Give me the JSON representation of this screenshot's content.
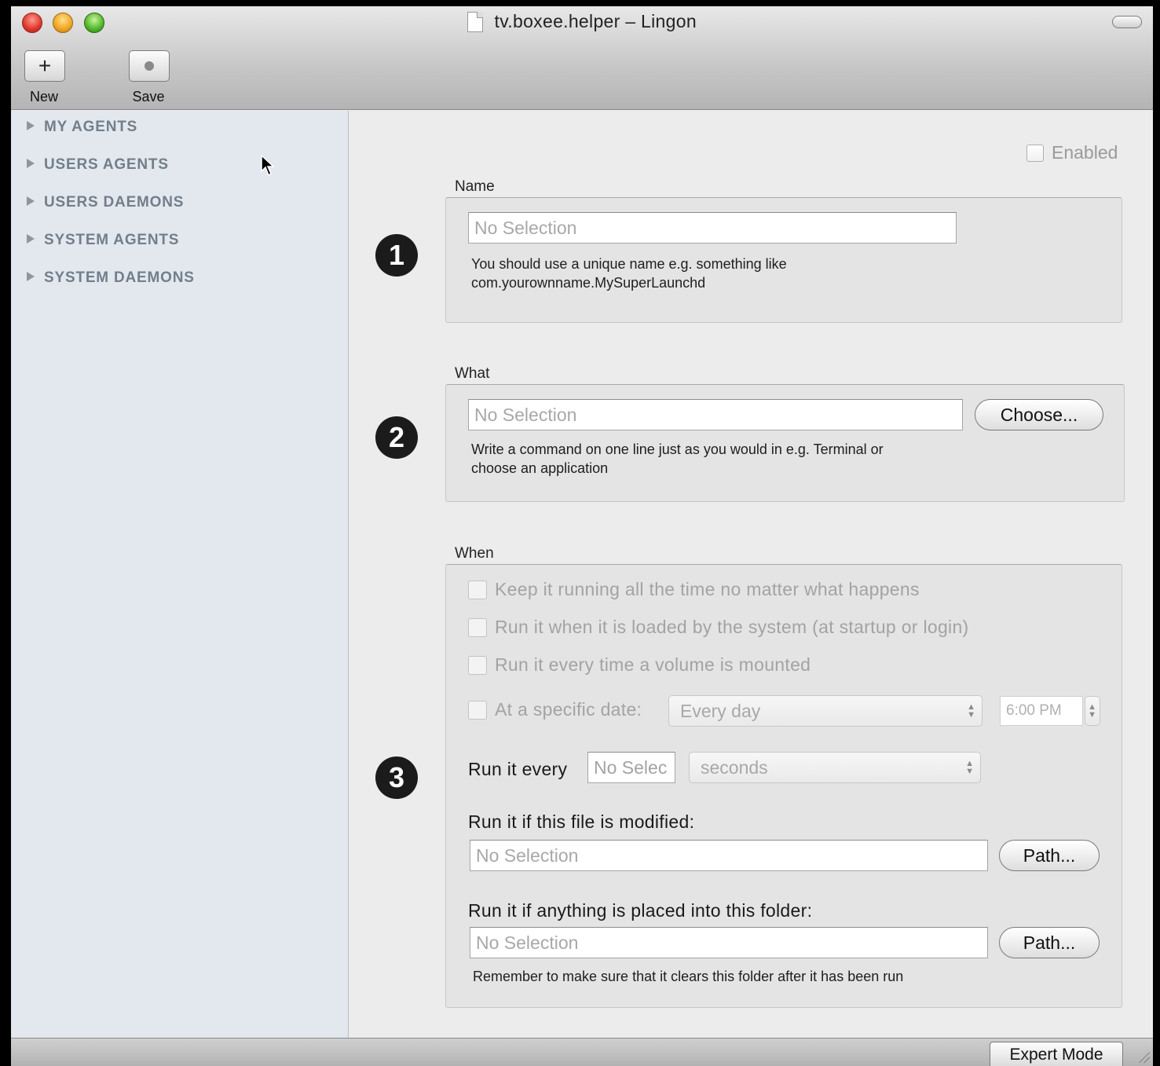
{
  "window": {
    "title": "tv.boxee.helper – Lingon"
  },
  "toolbar": {
    "new_label": "New",
    "save_label": "Save",
    "new_icon": "plus-icon",
    "save_icon": "record-dot-icon"
  },
  "sidebar": {
    "items": [
      {
        "label": "MY AGENTS"
      },
      {
        "label": "USERS AGENTS"
      },
      {
        "label": "USERS DAEMONS"
      },
      {
        "label": "SYSTEM AGENTS"
      },
      {
        "label": "SYSTEM DAEMONS"
      }
    ]
  },
  "main": {
    "enabled_label": "Enabled",
    "name": {
      "badge": "1",
      "label": "Name",
      "value": "No Selection",
      "help_line1": "You should use a unique name e.g. something like",
      "help_line2": "com.yourownname.MySuperLaunchd"
    },
    "what": {
      "badge": "2",
      "label": "What",
      "value": "No Selection",
      "choose_label": "Choose...",
      "help_line1": "Write a command on one line just as you would in e.g. Terminal or",
      "help_line2": "choose an application"
    },
    "when": {
      "badge": "3",
      "label": "When",
      "options": [
        "Keep it running all the time no matter what happens",
        "Run it when it is loaded by the system (at startup or login)",
        "Run it every time a volume is mounted"
      ],
      "specific_date_label": "At a specific date:",
      "specific_date_value": "Every day",
      "time_value": "6:00  PM",
      "run_every_label": "Run it every",
      "run_every_value": "No Selec",
      "run_every_unit": "seconds",
      "file_modified_label": "Run it if this file is modified:",
      "file_modified_value": "No Selection",
      "path_label": "Path...",
      "folder_label": "Run it if anything is placed into this folder:",
      "folder_value": "No Selection",
      "folder_help": "Remember to make sure that it clears this folder after it has been run"
    }
  },
  "bottom": {
    "expert_mode_label": "Expert Mode"
  }
}
